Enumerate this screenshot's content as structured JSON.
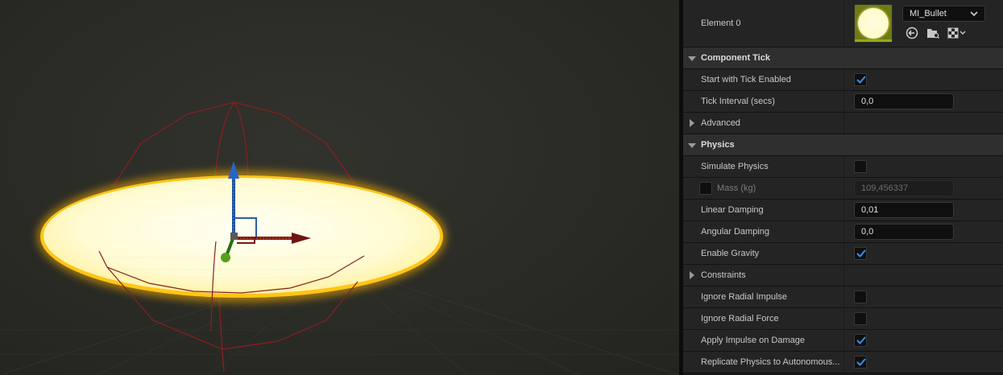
{
  "details": {
    "element0": {
      "label": "Element 0",
      "material_name": "MI_Bullet"
    },
    "component_tick": {
      "header": "Component Tick",
      "start_with_tick_enabled": {
        "label": "Start with Tick Enabled",
        "checked": true
      },
      "tick_interval": {
        "label": "Tick Interval (secs)",
        "value": "0,0"
      },
      "advanced": {
        "label": "Advanced"
      }
    },
    "physics": {
      "header": "Physics",
      "simulate_physics": {
        "label": "Simulate Physics",
        "checked": false
      },
      "mass": {
        "label": "Mass (kg)",
        "value": "109,456337",
        "override_checked": false
      },
      "linear_damping": {
        "label": "Linear Damping",
        "value": "0,01"
      },
      "angular_damping": {
        "label": "Angular Damping",
        "value": "0,0"
      },
      "enable_gravity": {
        "label": "Enable Gravity",
        "checked": true
      },
      "constraints": {
        "label": "Constraints"
      },
      "ignore_radial_impulse": {
        "label": "Ignore Radial Impulse",
        "checked": false
      },
      "ignore_radial_force": {
        "label": "Ignore Radial Force",
        "checked": false
      },
      "apply_impulse_on_damage": {
        "label": "Apply Impulse on Damage",
        "checked": true
      },
      "replicate_physics": {
        "label": "Replicate Physics to Autonomous...",
        "checked": true
      }
    }
  },
  "colors": {
    "checkbox_tick": "#3a8fe8",
    "gizmo_x": "#7a1a12",
    "gizmo_y": "#2c6e12",
    "gizmo_z": "#1c4e9a",
    "collision_wire": "#8a1f1f",
    "disc_glow": "#ffb700"
  },
  "icons": [
    "browse-asset-icon",
    "find-in-browser-icon",
    "checker-icon",
    "chevron-down-icon",
    "expand-arrow-icon",
    "collapse-arrow-icon"
  ]
}
